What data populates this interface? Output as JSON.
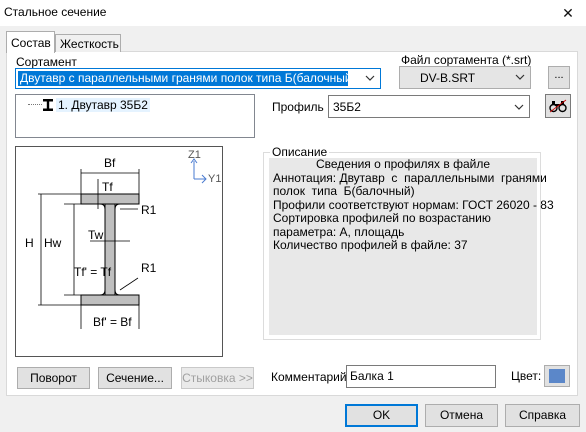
{
  "window": {
    "title": "Стальное сечение",
    "close_glyph": "✕"
  },
  "tabs": [
    {
      "label": "Состав",
      "active": true
    },
    {
      "label": "Жесткость",
      "active": false
    }
  ],
  "sortament": {
    "label": "Сортамент",
    "selected": "Двутавр  с  параллельными  гранями  полок  типа  Б(балочный)"
  },
  "file": {
    "label": "Файл сортамента (*.srt)",
    "selected": "DV-B.SRT",
    "browse_label": "..."
  },
  "tree": {
    "items": [
      {
        "label": "1. Двутавр 35Б2"
      }
    ]
  },
  "profile": {
    "label": "Профиль",
    "selected": "35Б2"
  },
  "drawing": {
    "axis_z": "Z1",
    "axis_y": "Y1",
    "Bf_top": "Bf",
    "Tf_top": "Tf",
    "R1_top": "R1",
    "Tw": "Tw",
    "H": "H",
    "Hw": "Hw",
    "Tf_bottom": "Tf' = Tf",
    "R1_bottom": "R1",
    "Bf_bottom": "Bf' = Bf"
  },
  "description": {
    "legend": "Описание",
    "heading": "Сведения о профилях в файле",
    "lines": [
      "Аннотация: Двутавр  с  параллельными  гранями",
      "полок  типа  Б(балочный)",
      "Профили соответствуют нормам: ГОСТ 26020 - 83",
      "Сортировка профилей по возрастанию",
      "параметра: А, площадь",
      "Количество профилей в файле: 37"
    ]
  },
  "buttons": {
    "rotate": "Поворот",
    "section": "Сечение...",
    "dock": "Стыковка >>",
    "ok": "OK",
    "cancel": "Отмена",
    "help": "Справка"
  },
  "comment": {
    "label": "Комментарий:",
    "value": "Балка 1"
  },
  "color": {
    "label": "Цвет:",
    "swatch": "#5b87c9"
  }
}
